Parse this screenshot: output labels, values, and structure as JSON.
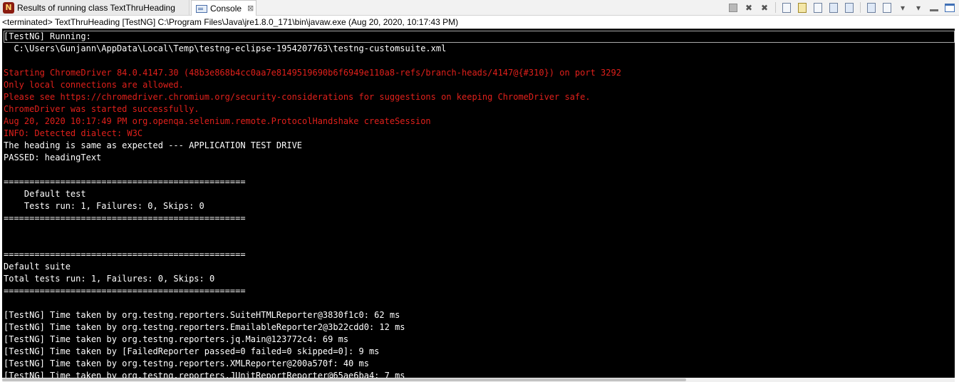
{
  "tabs": [
    {
      "label": "Results of running class TextThruHeading",
      "icon": "testng-icon",
      "active": false
    },
    {
      "label": "Console",
      "icon": "console-icon",
      "active": true,
      "close": "⊠"
    }
  ],
  "toolbar": {
    "buttons": [
      {
        "name": "terminate-icon"
      },
      {
        "name": "remove-launch-icon"
      },
      {
        "name": "remove-all-terminated-icon"
      },
      {
        "name": "clear-console-icon"
      },
      {
        "name": "scroll-lock-icon"
      },
      {
        "name": "word-wrap-icon"
      },
      {
        "name": "show-stdout-icon"
      },
      {
        "name": "show-stderr-icon"
      },
      {
        "name": "pin-console-icon"
      },
      {
        "name": "display-selected-console-icon"
      },
      {
        "name": "open-console-icon"
      },
      {
        "name": "view-menu-icon"
      },
      {
        "name": "minimize-icon"
      },
      {
        "name": "maximize-icon"
      }
    ]
  },
  "status": "<terminated> TextThruHeading [TestNG] C:\\Program Files\\Java\\jre1.8.0_171\\bin\\javaw.exe (Aug 20, 2020, 10:17:43 PM)",
  "console": {
    "colors": {
      "stdout": "#ffffff",
      "stderr": "#e0201b",
      "background": "#000000"
    },
    "lines": [
      {
        "text": "[TestNG] Running:",
        "stream": "out"
      },
      {
        "text": "  C:\\Users\\Gunjann\\AppData\\Local\\Temp\\testng-eclipse-1954207763\\testng-customsuite.xml",
        "stream": "out"
      },
      {
        "text": "",
        "stream": "out"
      },
      {
        "text": "Starting ChromeDriver 84.0.4147.30 (48b3e868b4cc0aa7e8149519690b6f6949e110a8-refs/branch-heads/4147@{#310}) on port 3292",
        "stream": "err"
      },
      {
        "text": "Only local connections are allowed.",
        "stream": "err"
      },
      {
        "text": "Please see https://chromedriver.chromium.org/security-considerations for suggestions on keeping ChromeDriver safe.",
        "stream": "err"
      },
      {
        "text": "ChromeDriver was started successfully.",
        "stream": "err"
      },
      {
        "text": "Aug 20, 2020 10:17:49 PM org.openqa.selenium.remote.ProtocolHandshake createSession",
        "stream": "err"
      },
      {
        "text": "INFO: Detected dialect: W3C",
        "stream": "err"
      },
      {
        "text": "The heading is same as expected --- APPLICATION TEST DRIVE",
        "stream": "out"
      },
      {
        "text": "PASSED: headingText",
        "stream": "out"
      },
      {
        "text": "",
        "stream": "out"
      },
      {
        "text": "===============================================",
        "stream": "out"
      },
      {
        "text": "    Default test",
        "stream": "out"
      },
      {
        "text": "    Tests run: 1, Failures: 0, Skips: 0",
        "stream": "out"
      },
      {
        "text": "===============================================",
        "stream": "out"
      },
      {
        "text": "",
        "stream": "out"
      },
      {
        "text": "",
        "stream": "out"
      },
      {
        "text": "===============================================",
        "stream": "out"
      },
      {
        "text": "Default suite",
        "stream": "out"
      },
      {
        "text": "Total tests run: 1, Failures: 0, Skips: 0",
        "stream": "out"
      },
      {
        "text": "===============================================",
        "stream": "out"
      },
      {
        "text": "",
        "stream": "out"
      },
      {
        "text": "[TestNG] Time taken by org.testng.reporters.SuiteHTMLReporter@3830f1c0: 62 ms",
        "stream": "out"
      },
      {
        "text": "[TestNG] Time taken by org.testng.reporters.EmailableReporter2@3b22cdd0: 12 ms",
        "stream": "out"
      },
      {
        "text": "[TestNG] Time taken by org.testng.reporters.jq.Main@123772c4: 69 ms",
        "stream": "out"
      },
      {
        "text": "[TestNG] Time taken by [FailedReporter passed=0 failed=0 skipped=0]: 9 ms",
        "stream": "out"
      },
      {
        "text": "[TestNG] Time taken by org.testng.reporters.XMLReporter@200a570f: 40 ms",
        "stream": "out"
      },
      {
        "text": "[TestNG] Time taken by org.testng.reporters.JUnitReportReporter@65ae6ba4: 7 ms",
        "stream": "out"
      }
    ]
  }
}
